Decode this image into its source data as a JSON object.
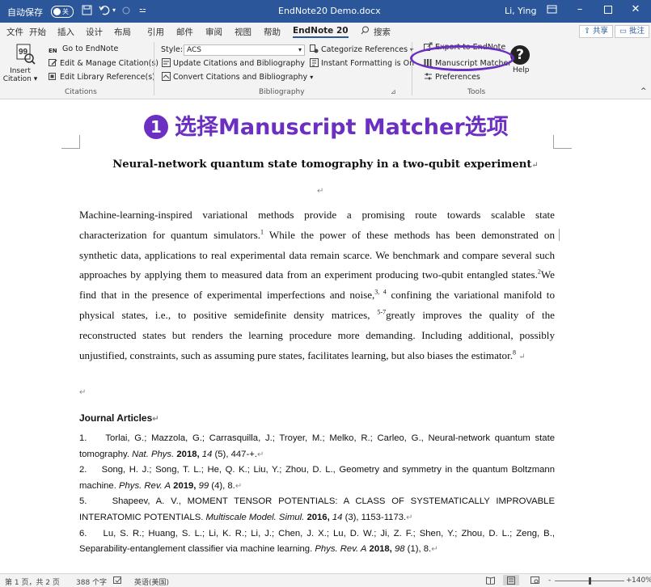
{
  "titlebar": {
    "autosave_label": "自动保存",
    "autosave_state": "关",
    "doc_title": "EndNote20 Demo.docx",
    "user": "Li, Ying",
    "icons": [
      "save-icon",
      "undo-icon",
      "redo-icon",
      "customize-icon",
      "ribbon-display-icon",
      "minimize-icon",
      "maximize-icon",
      "close-icon"
    ]
  },
  "menubar": {
    "tabs": [
      "文件",
      "开始",
      "插入",
      "设计",
      "布局",
      "引用",
      "邮件",
      "审阅",
      "视图",
      "帮助",
      "EndNote 20"
    ],
    "search": "搜索",
    "share": "共享",
    "comment": "批注"
  },
  "ribbon": {
    "insert_citation": "Insert\nCitation",
    "insert_line1": "Insert",
    "insert_line2": "Citation",
    "go_to_endnote": "Go to EndNote",
    "edit_manage": "Edit & Manage Citation(s)",
    "edit_library": "Edit Library Reference(s)",
    "citations_group": "Citations",
    "style_label": "Style:",
    "style_value": "ACS",
    "update_citations": "Update Citations and Bibliography",
    "convert_citations": "Convert Citations and Bibliography",
    "categorize": "Categorize References",
    "instant_formatting": "Instant Formatting is On",
    "bibliography_group": "Bibliography",
    "export": "Export to EndNote",
    "manuscript_matcher": "Manuscript Matcher",
    "preferences": "Preferences",
    "help": "Help",
    "tools_group": "Tools"
  },
  "annotation": {
    "number": "1",
    "text": "选择Manuscript Matcher选项"
  },
  "document": {
    "title": "Neural-network quantum state tomography in a two-qubit experiment",
    "paragraph": {
      "p1": "Machine-learning-inspired variational methods provide a promising route towards scalable state characterization for quantum simulators.",
      "s1": "1",
      "p2": " While the power of these methods has been demonstrated on synthetic data, applications to real experimental data remain scarce. We benchmark and compare several such approaches by applying them to measured data from an experiment producing two-qubit entangled states.",
      "s2": "2",
      "p3": "We find that in the presence of experimental imperfections and noise,",
      "s3": "3, 4",
      "p4": " confining the variational manifold to physical states, i.e., to positive semidefinite density matrices, ",
      "s4": "5-7",
      "p5": "greatly improves the quality of the reconstructed states but renders the learning procedure more demanding. Including additional, possibly unjustified, constraints, such as assuming pure states, facilitates learning, but also biases the estimator.",
      "s5": "8"
    },
    "references_heading": "Journal Articles",
    "references": [
      {
        "num": "1.",
        "authors": "Torlai, G.;   Mazzola, G.;   Carrasquilla, J.;   Troyer, M.;   Melko, R.; Carleo, G., Neural-network quantum state tomography. ",
        "journal": "Nat. Phys.",
        "year": "2018,",
        "vol": "14",
        "rest": " (5), 447-+."
      },
      {
        "num": "2.",
        "authors": "Song, H. J.;   Song, T. L.;   He, Q. K.;   Liu, Y.; Zhou, D. L., Geometry and symmetry in the quantum Boltzmann machine. ",
        "journal": "Phys. Rev. A",
        "year": "2019,",
        "vol": "99",
        "rest": " (4), 8."
      },
      {
        "num": "5.",
        "authors": "Shapeev, A. V., MOMENT TENSOR POTENTIALS: A CLASS OF SYSTEMATICALLY IMPROVABLE INTERATOMIC POTENTIALS. ",
        "journal": "Multiscale Model. Simul.",
        "year": "2016,",
        "vol": "14",
        "rest": " (3), 1153-1173."
      },
      {
        "num": "6.",
        "authors": "Lu, S. R.;   Huang, S. L.;   Li, K. R.;   Li, J.;   Chen, J. X.;   Lu, D. W.;   Ji, Z. F.;   Shen, Y.;   Zhou, D. L.; Zeng, B., Separability-entanglement classifier via machine learning. ",
        "journal": "Phys. Rev. A",
        "year": "2018,",
        "vol": "98",
        "rest": " (1), 8."
      }
    ]
  },
  "statusbar": {
    "page": "第 1 页，共 2 页",
    "words": "388 个字",
    "language": "英语(美国)",
    "zoom": "140%",
    "zoom_minus": "-",
    "zoom_plus": "+"
  }
}
